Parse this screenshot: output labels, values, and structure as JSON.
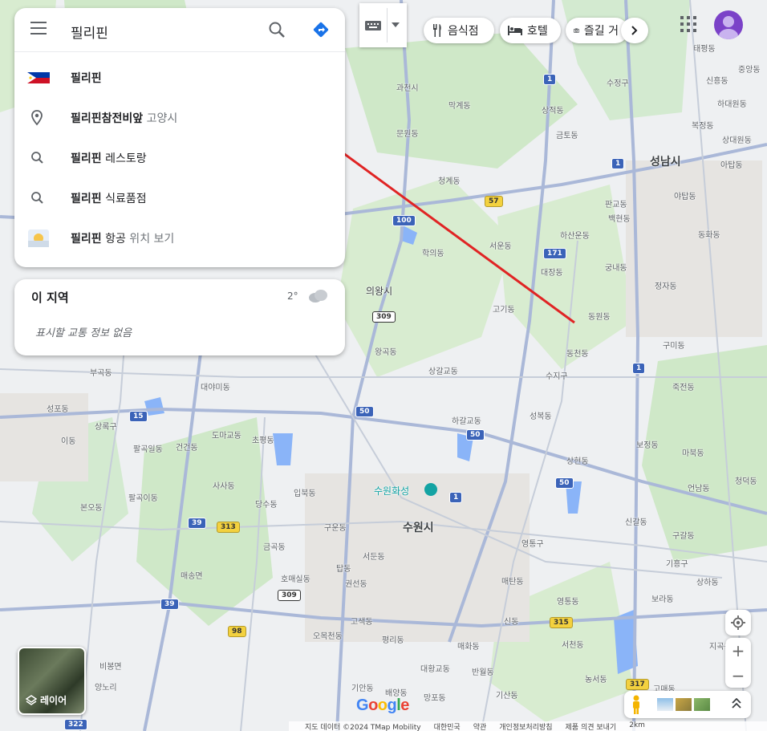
{
  "search": {
    "query": "필리핀",
    "suggestions": [
      {
        "icon": "flag-icon",
        "bold": "필리핀",
        "rest": "",
        "sub": ""
      },
      {
        "icon": "pin-icon",
        "bold": "필리핀",
        "rest": "참전비앞",
        "sub": " 고양시"
      },
      {
        "icon": "search-icon",
        "bold": "필리핀",
        "rest": " 레스토랑",
        "sub": ""
      },
      {
        "icon": "search-icon",
        "bold": "필리핀",
        "rest": " 식료품점",
        "sub": ""
      },
      {
        "icon": "airplane-icon",
        "bold": "필리핀",
        "rest": " 항공",
        "sub": " 위치 보기"
      }
    ]
  },
  "area": {
    "title": "이 지역",
    "temp": "2°",
    "note": "표시할 교통 정보 없음"
  },
  "categories": [
    "음식점",
    "호텔",
    "즐길 거"
  ],
  "layers_label": "레이어",
  "footer": [
    "지도 데이터 ©2024 TMap Mobility",
    "대한민국",
    "약관",
    "개인정보처리방침",
    "제품 의견 보내기",
    "2km"
  ],
  "map_labels": {
    "cities": [
      "성남시",
      "수원시",
      "의왕시"
    ],
    "places": [
      "과천시",
      "문원동",
      "막계동",
      "상적동",
      "금토동",
      "청계동",
      "학의동",
      "서운동",
      "고기동",
      "동원동",
      "동천동",
      "수지구",
      "상현동",
      "성복동",
      "하갈교동",
      "상갈교동",
      "왕곡동",
      "부곡동",
      "대야미동",
      "도마교동",
      "초평동",
      "성포동",
      "상록구",
      "팔곡일동",
      "건건동",
      "사사동",
      "당수동",
      "팔곡이동",
      "본오동",
      "입북동",
      "구운동",
      "금곡동",
      "호매실동",
      "탑동",
      "권선동",
      "서둔동",
      "매송면",
      "고색동",
      "오목천동",
      "평리동",
      "대황교동",
      "망포동",
      "반월동",
      "기산동",
      "배양동",
      "기안동",
      "양노리",
      "영통구",
      "매탄동",
      "신동",
      "영통동",
      "매화동",
      "서천동",
      "농서동",
      "보정동",
      "마북동",
      "죽전동",
      "구미동",
      "정자동",
      "백현동",
      "궁내동",
      "대장동",
      "하산운동",
      "판교동",
      "동화동",
      "신흥동",
      "하대원동",
      "아탑동",
      "수정구",
      "야탑동",
      "중앙동",
      "상대원동",
      "복정동",
      "태평동",
      "이동",
      "비봉면",
      "고매동",
      "청덕동",
      "언남동",
      "신갈동",
      "구갈동",
      "기흥구",
      "상하동",
      "지곡동",
      "보라동"
    ],
    "shields": [
      "1",
      "1",
      "57",
      "100",
      "171",
      "309",
      "309",
      "1",
      "15",
      "50",
      "50",
      "50",
      "39",
      "39",
      "313",
      "98",
      "315",
      "317",
      "322",
      "1"
    ]
  },
  "route_tooltip_arrow": "red",
  "accent": "#1a73e8",
  "arrow_color": "#e02424",
  "place_title": "수원화성"
}
